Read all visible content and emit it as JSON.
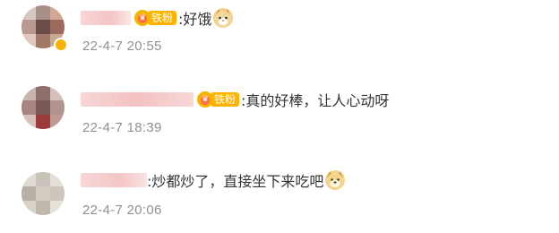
{
  "comments": [
    {
      "badge_label": "铁粉",
      "text": ":好饿",
      "emoji": "cat-face-emoji",
      "time": "22-4-7 20:55"
    },
    {
      "badge_label": "铁粉",
      "text": ":真的好棒，让人心动呀",
      "emoji": "",
      "time": "22-4-7 18:39"
    },
    {
      "badge_label": "",
      "text": ":炒都炒了，直接坐下来吃吧",
      "emoji": "doge-emoji",
      "time": "22-4-7 20:06"
    }
  ],
  "colors": {
    "time": "#909090",
    "text": "#333333",
    "badge": "#ffb300",
    "vip": "#f5b400"
  }
}
